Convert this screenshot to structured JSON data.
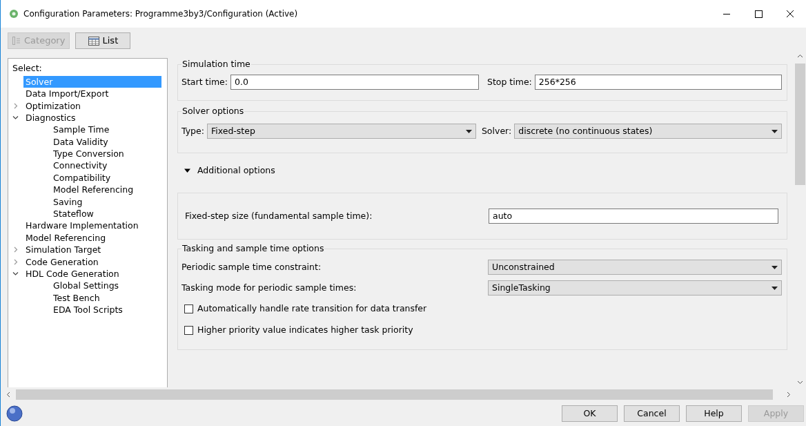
{
  "window": {
    "title": "Configuration Parameters: Programme3by3/Configuration (Active)"
  },
  "toolbar": [
    {
      "label": "Category",
      "disabled": true,
      "kind": "category"
    },
    {
      "label": "List",
      "disabled": false,
      "kind": "list"
    }
  ],
  "tree": {
    "heading": "Select:",
    "items": [
      {
        "label": "Solver",
        "selected": true
      },
      {
        "label": "Data Import/Export",
        "selected": false
      },
      {
        "label": "Optimization",
        "selected": false,
        "expanded": false
      },
      {
        "label": "Diagnostics",
        "selected": false,
        "expanded": true,
        "children": [
          {
            "label": "Sample Time",
            "selected": false
          },
          {
            "label": "Data Validity",
            "selected": false
          },
          {
            "label": "Type Conversion",
            "selected": false
          },
          {
            "label": "Connectivity",
            "selected": false
          },
          {
            "label": "Compatibility",
            "selected": false
          },
          {
            "label": "Model Referencing",
            "selected": false
          },
          {
            "label": "Saving",
            "selected": false
          },
          {
            "label": "Stateflow",
            "selected": false
          }
        ]
      },
      {
        "label": "Hardware Implementation",
        "selected": false
      },
      {
        "label": "Model Referencing",
        "selected": false
      },
      {
        "label": "Simulation Target",
        "selected": false,
        "expanded": false
      },
      {
        "label": "Code Generation",
        "selected": false,
        "expanded": false
      },
      {
        "label": "HDL Code Generation",
        "selected": false,
        "expanded": true,
        "children": [
          {
            "label": "Global Settings",
            "selected": false
          },
          {
            "label": "Test Bench",
            "selected": false
          },
          {
            "label": "EDA Tool Scripts",
            "selected": false
          }
        ]
      }
    ]
  },
  "simulation_time": {
    "title": "Simulation time",
    "start_label": "Start time:",
    "start_value": "0.0",
    "stop_label": "Stop time:",
    "stop_value": "256*256"
  },
  "solver_options": {
    "title": "Solver options",
    "type_label": "Type:",
    "type_value": "Fixed-step",
    "solver_label": "Solver:",
    "solver_value": "discrete (no continuous states)"
  },
  "additional_options": {
    "label": "Additional options",
    "expanded": true,
    "step_label": "Fixed-step size (fundamental sample time):",
    "step_value": "auto"
  },
  "tasking": {
    "title": "Tasking and sample time options",
    "rows": [
      {
        "label": "Periodic sample time constraint:",
        "value": "Unconstrained"
      },
      {
        "label": "Tasking mode for periodic sample times:",
        "value": "SingleTasking"
      }
    ],
    "checkboxes": [
      {
        "label": "Automatically handle rate transition for data transfer",
        "checked": false
      },
      {
        "label": "Higher priority value indicates higher task priority",
        "checked": false
      }
    ]
  },
  "buttons": [
    {
      "label": "OK",
      "disabled": false
    },
    {
      "label": "Cancel",
      "disabled": false
    },
    {
      "label": "Help",
      "disabled": false
    },
    {
      "label": "Apply",
      "disabled": true
    }
  ]
}
